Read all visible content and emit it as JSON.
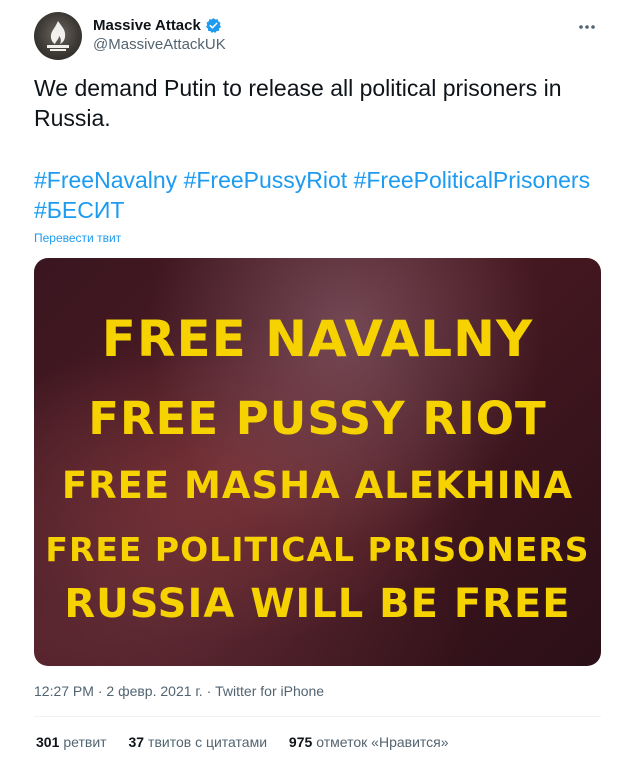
{
  "author": {
    "display_name": "Massive Attack",
    "handle": "@MassiveAttackUK",
    "verified": true,
    "avatar_icon": "flame-logo"
  },
  "tweet": {
    "text": "We demand Putin to release all political prisoners in Russia.",
    "hashtags": [
      "#FreeNavalny",
      "#FreePussyRiot",
      "#FreePoliticalPrisoners",
      "#БЕСИТ"
    ],
    "translate_label": "Перевести твит"
  },
  "media": {
    "lines": [
      "FREE NAVALNY",
      "FREE PUSSY RIOT",
      "FREE MASHA ALEKHINA",
      "FREE POLITICAL PRISONERS",
      "RUSSIA WILL BE FREE"
    ],
    "text_color": "#f5d200"
  },
  "meta": {
    "time": "12:27 PM",
    "date": "2 февр. 2021 г.",
    "separator": "·",
    "source": "Twitter for iPhone"
  },
  "stats": {
    "retweets_count": "301",
    "retweets_label": "ретвит",
    "quotes_count": "37",
    "quotes_label": "твитов с цитатами",
    "likes_count": "975",
    "likes_label": "отметок «Нравится»"
  },
  "colors": {
    "accent": "#1d9bf0",
    "secondary_text": "#536471",
    "primary_text": "#0f1419"
  }
}
